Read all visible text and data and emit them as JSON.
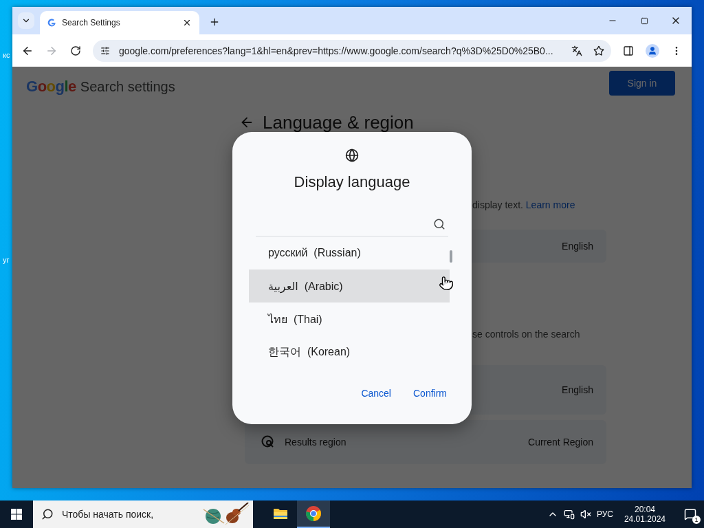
{
  "desktop": {
    "icon_labels": [
      "кс",
      "уг"
    ]
  },
  "browser": {
    "tabs": [
      {
        "title": "Search Settings",
        "selected": true
      }
    ],
    "forward_disabled": true,
    "url": "google.com/preferences?lang=1&hl=en&prev=https://www.google.com/search?q%3D%25D0%25B0..."
  },
  "page": {
    "logo": "Google",
    "title": "Search settings",
    "sign_in": "Sign in",
    "heading": "Language & region",
    "fragments": [
      {
        "text": "display text.",
        "link": "Learn more"
      },
      {
        "text": "se controls on the search"
      }
    ],
    "cards": [
      {
        "value": "English"
      },
      {
        "value": "English"
      },
      {
        "label": "Results region",
        "value": "Current Region"
      }
    ]
  },
  "dialog": {
    "title": "Display language",
    "items": [
      {
        "label": "русский  (Russian)",
        "highlighted": false
      },
      {
        "label": "العربية  (Arabic)",
        "highlighted": true
      },
      {
        "label": "ไทย  (Thai)",
        "highlighted": false
      },
      {
        "label": "한국어  (Korean)",
        "highlighted": false
      }
    ],
    "buttons": [
      "Cancel",
      "Confirm"
    ]
  },
  "taskbar": {
    "search_placeholder": "Чтобы начать поиск,",
    "apps": [
      {
        "kind": "explorer",
        "selected": false
      },
      {
        "kind": "chrome",
        "selected": true
      }
    ],
    "language": "РУС",
    "time": "20:04",
    "date": "24.01.2024",
    "notifications": "1"
  }
}
